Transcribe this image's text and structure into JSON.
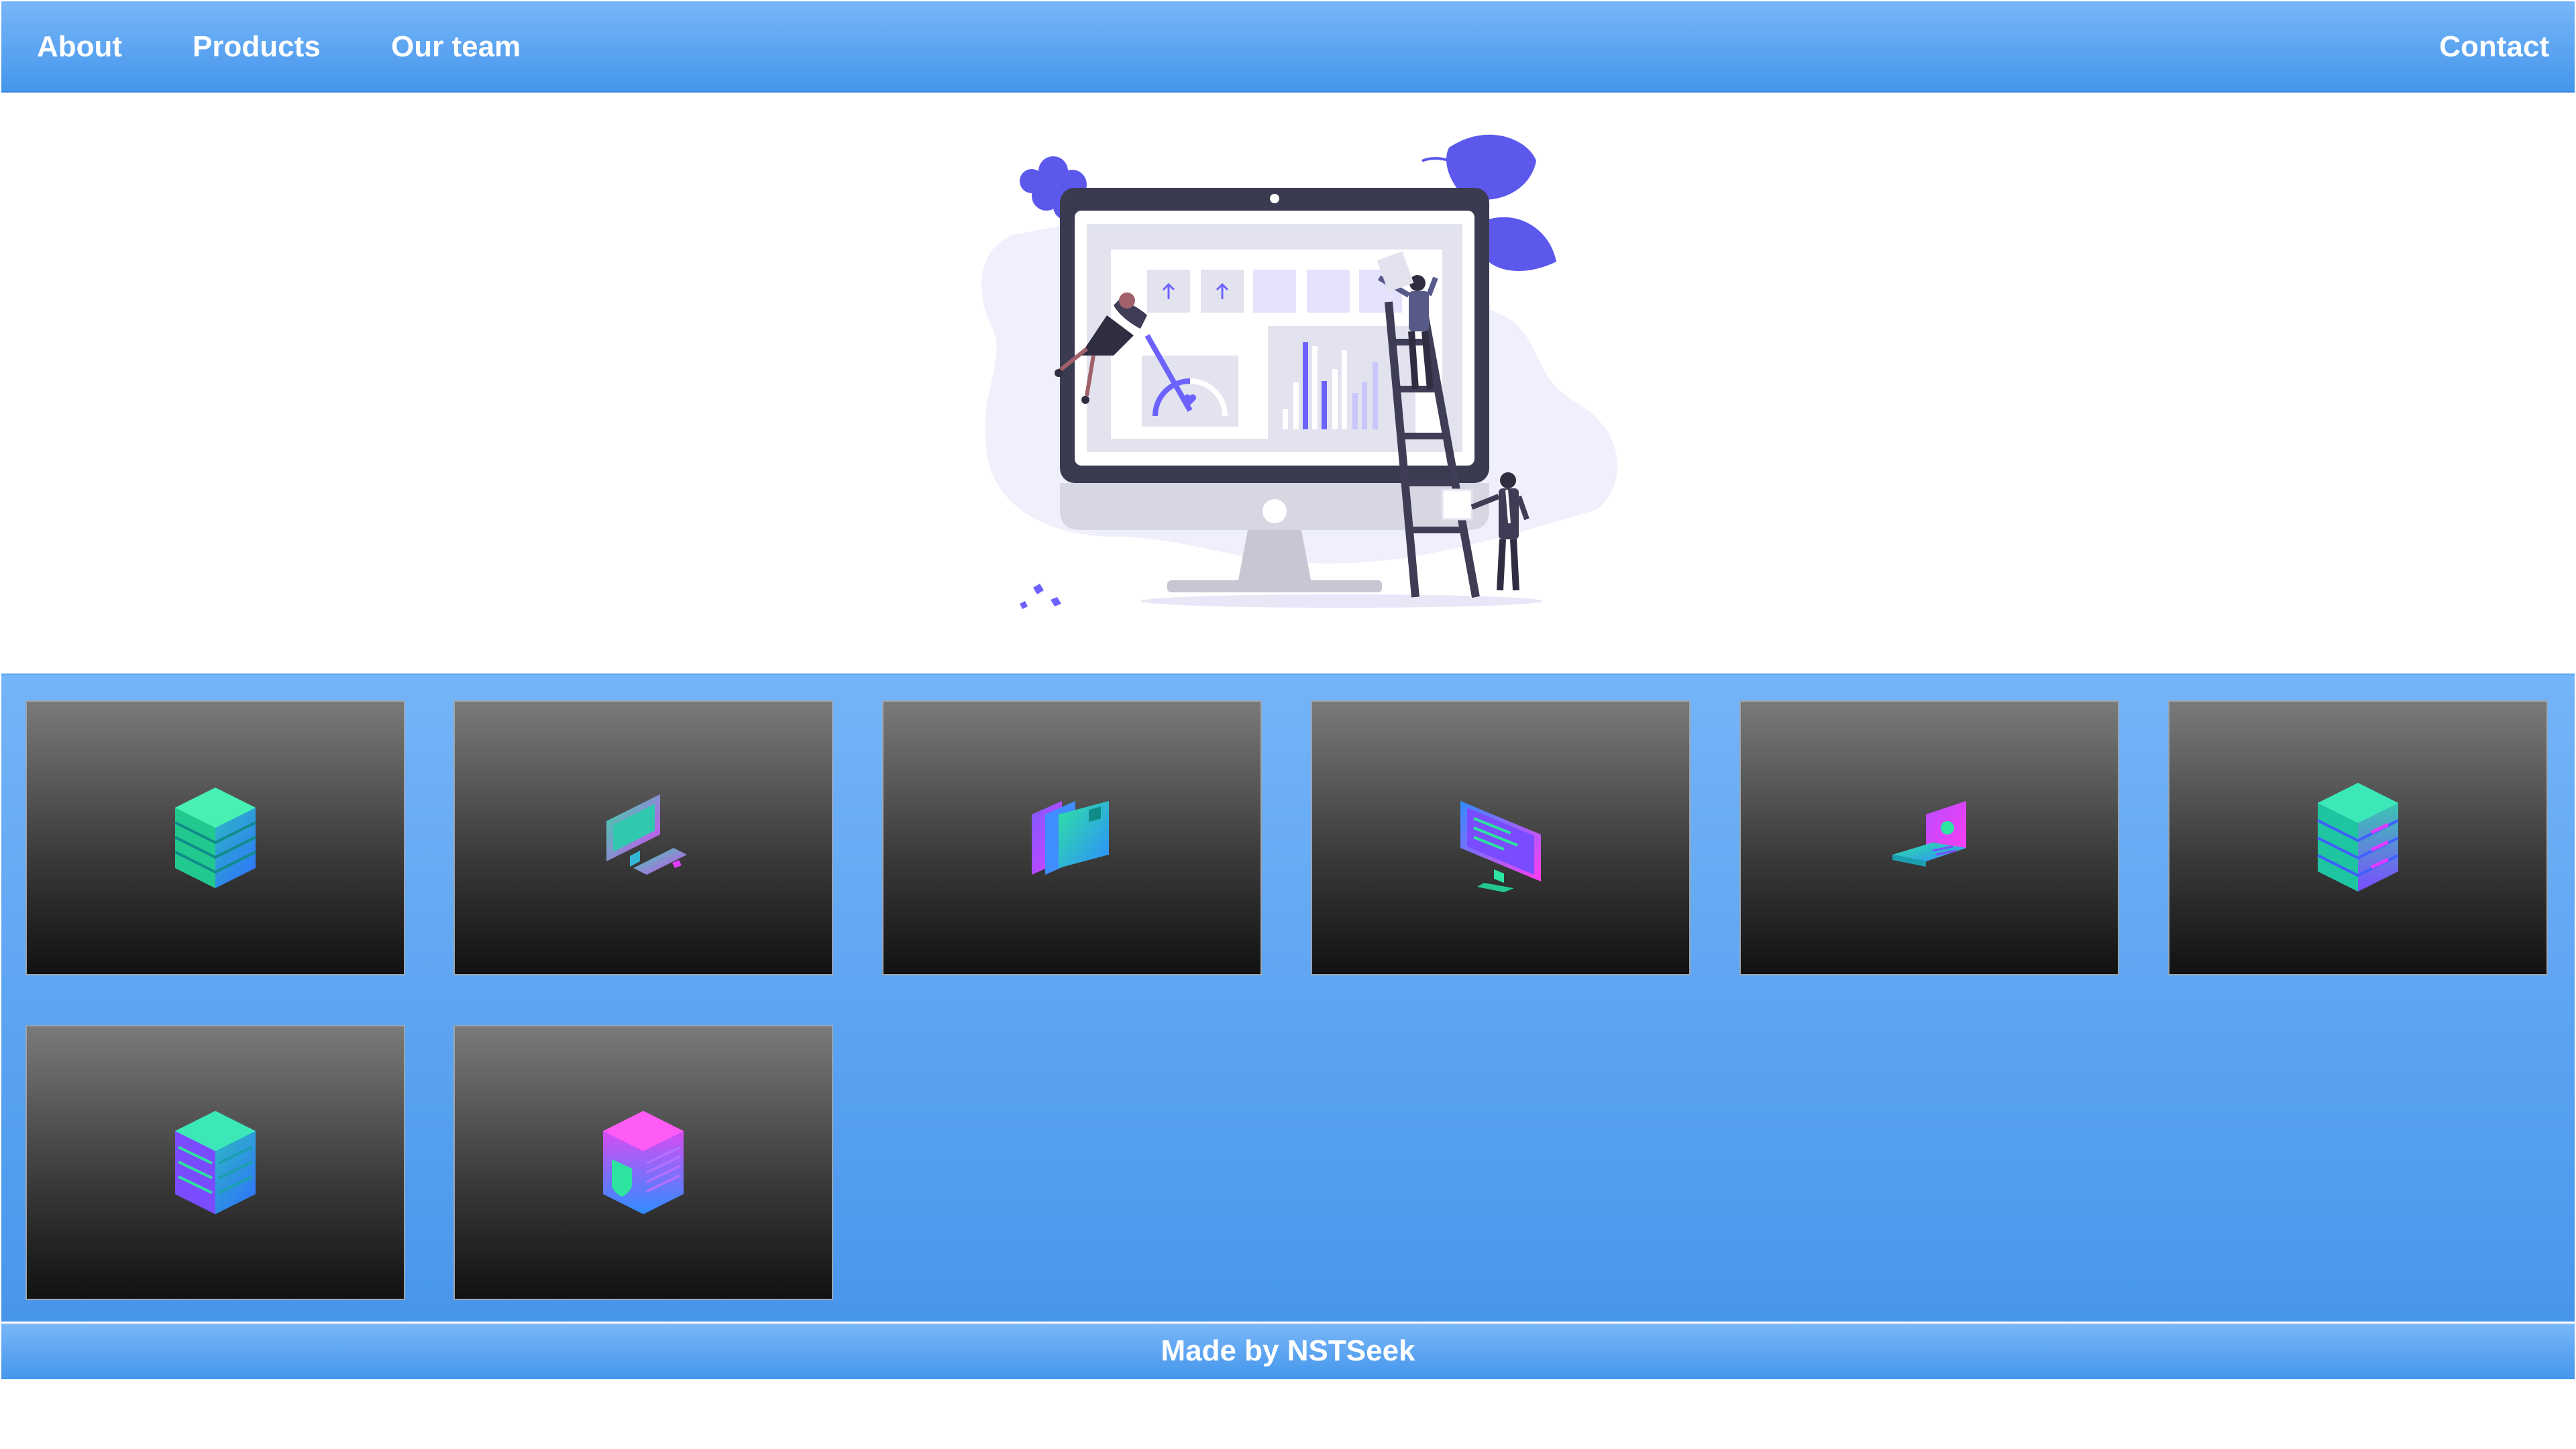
{
  "nav": {
    "about": "About",
    "products": "Products",
    "team": "Our team",
    "contact": "Contact"
  },
  "hero": {
    "illustration": "dashboard-illustration"
  },
  "products": {
    "items": [
      {
        "icon": "database-server-icon"
      },
      {
        "icon": "desktop-computer-icon"
      },
      {
        "icon": "file-cards-icon"
      },
      {
        "icon": "monitor-icon"
      },
      {
        "icon": "laptop-icon"
      },
      {
        "icon": "server-rack-icon"
      },
      {
        "icon": "storage-server-icon"
      },
      {
        "icon": "shield-database-icon"
      }
    ]
  },
  "footer": {
    "credit": "Made by NSTSeek"
  },
  "colors": {
    "nav_top": "#78b6f8",
    "nav_bottom": "#4596ec",
    "illustration_accent": "#6c63ff",
    "icon_green": "#22e3a0",
    "icon_blue": "#3f8dff",
    "icon_magenta": "#e03cff"
  }
}
